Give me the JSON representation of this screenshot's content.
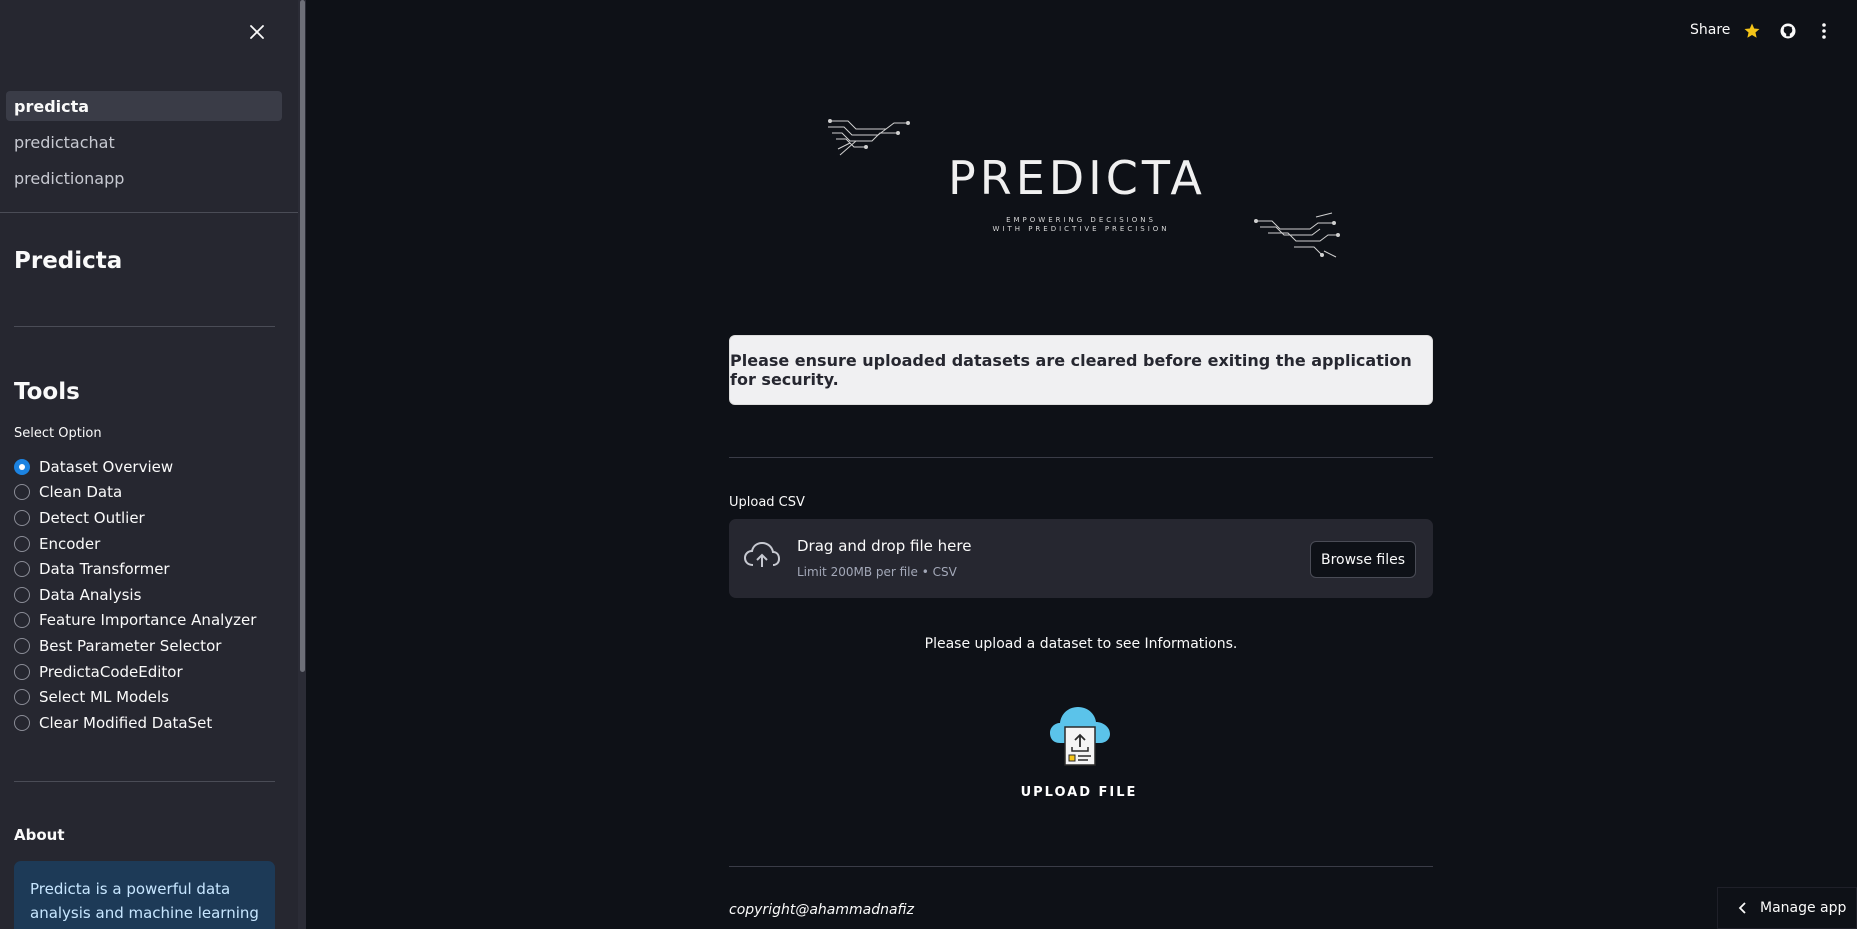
{
  "sidebar": {
    "nav_items": [
      {
        "label": "predicta",
        "active": true
      },
      {
        "label": "predictachat",
        "active": false
      },
      {
        "label": "predictionapp",
        "active": false
      }
    ],
    "title": "Predicta",
    "tools_heading": "Tools",
    "select_label": "Select Option",
    "options": [
      {
        "label": "Dataset Overview",
        "selected": true
      },
      {
        "label": "Clean Data",
        "selected": false
      },
      {
        "label": "Detect Outlier",
        "selected": false
      },
      {
        "label": "Encoder",
        "selected": false
      },
      {
        "label": "Data Transformer",
        "selected": false
      },
      {
        "label": "Data Analysis",
        "selected": false
      },
      {
        "label": "Feature Importance Analyzer",
        "selected": false
      },
      {
        "label": "Best Parameter Selector",
        "selected": false
      },
      {
        "label": "PredictaCodeEditor",
        "selected": false
      },
      {
        "label": "Select ML Models",
        "selected": false
      },
      {
        "label": "Clear Modified DataSet",
        "selected": false
      }
    ],
    "about_heading": "About",
    "about_text": "Predicta is a powerful data analysis and machine learning"
  },
  "header": {
    "share_label": "Share",
    "icons": [
      "star-icon",
      "github-icon",
      "kebab-menu-icon"
    ]
  },
  "logo": {
    "title": "PREDICTA",
    "tagline_line1": "EMPOWERING DECISIONS",
    "tagline_line2": "WITH PREDICTIVE PRECISION"
  },
  "main": {
    "notice": "Please ensure uploaded datasets are cleared before exiting the application for security.",
    "upload_label": "Upload CSV",
    "dropzone_title": "Drag and drop file here",
    "dropzone_sub": "Limit 200MB per file • CSV",
    "browse_label": "Browse files",
    "info_message": "Please upload a dataset to see Informations.",
    "illustration_caption": "UPLOAD FILE",
    "copyright": "copyright@ahammadnafiz"
  },
  "footer": {
    "manage_label": "Manage app"
  },
  "colors": {
    "background": "#0e1117",
    "sidebar": "#262730",
    "accent": "#1c83e1",
    "star": "#f5c518",
    "cloud": "#5bc3ea"
  }
}
